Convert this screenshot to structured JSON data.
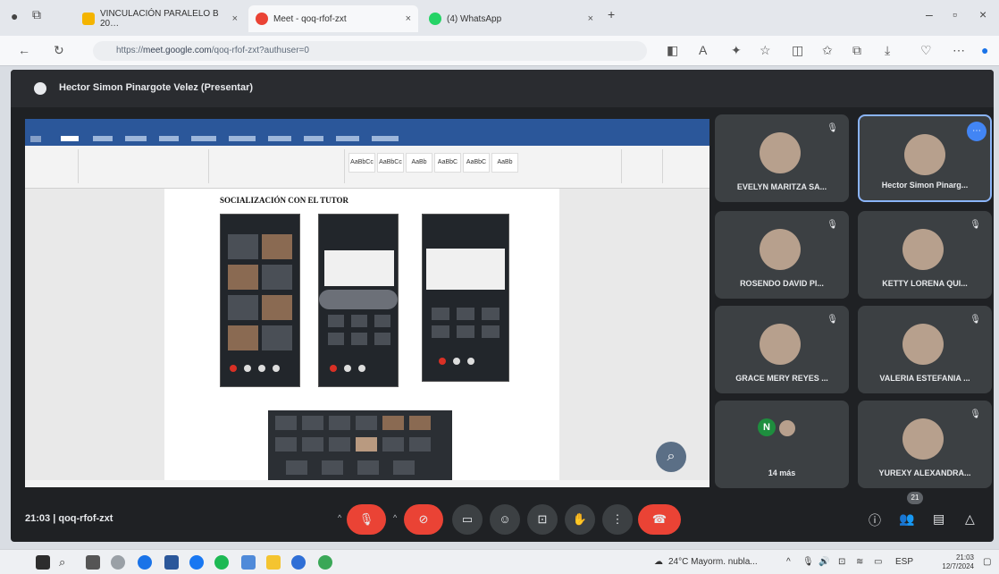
{
  "browser": {
    "tabs": [
      {
        "label": "VINCULACIÓN PARALELO B 20…",
        "active": false
      },
      {
        "label": "Meet - qoq-rfof-zxt",
        "active": true
      },
      {
        "label": "(4) WhatsApp",
        "active": false
      }
    ],
    "url_prefix": "https://",
    "url_host": "meet.google.com",
    "url_path": "/qoq-rfof-zxt?authuser=0"
  },
  "meet": {
    "presenter_label": "Hector Simon Pinargote Velez (Presentar)",
    "meeting_time": "21:03",
    "meeting_code": "qoq-rfof-zxt",
    "participant_count": "21",
    "shared_doc": {
      "heading": "SOCIALIZACIÓN CON EL TUTOR"
    },
    "participants": [
      {
        "name": "EVELYN MARITZA SA...",
        "highlight": false
      },
      {
        "name": "Hector Simon Pinarg...",
        "highlight": true
      },
      {
        "name": "ROSENDO DAVID PI...",
        "highlight": false
      },
      {
        "name": "KETTY LORENA QUI...",
        "highlight": false
      },
      {
        "name": "GRACE MERY REYES ...",
        "highlight": false
      },
      {
        "name": "VALERIA ESTEFANIA ...",
        "highlight": false
      },
      {
        "name": "14 más",
        "highlight": false,
        "avatar_letter": "N"
      },
      {
        "name": "YUREXY ALEXANDRA...",
        "highlight": false
      }
    ]
  },
  "taskbar": {
    "weather": "24°C  Mayorm. nubla...",
    "lang": "ESP",
    "time": "21:03",
    "date": "12/7/2024"
  },
  "colors": {
    "meet_bg": "#1f2124",
    "tile_bg": "#3c4043",
    "end_call_red": "#ea4335",
    "word_blue": "#2b579a"
  }
}
